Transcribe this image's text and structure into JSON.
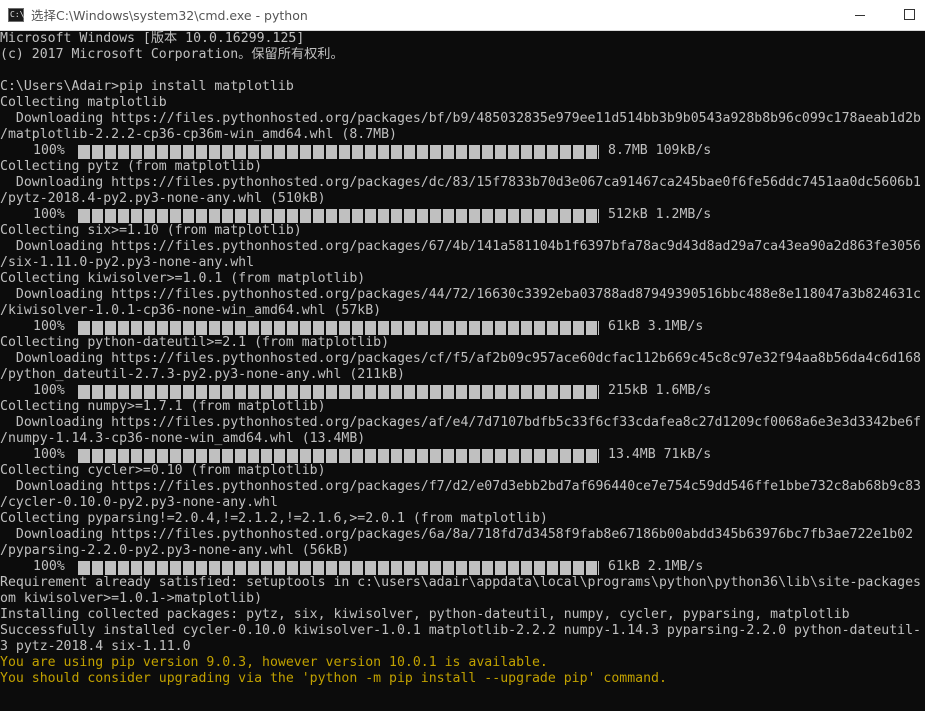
{
  "window": {
    "title": "选择C:\\Windows\\system32\\cmd.exe - python",
    "icon_text": "C:\\"
  },
  "console": {
    "lines": [
      {
        "kind": "text",
        "text": "Microsoft Windows [版本 10.0.16299.125]"
      },
      {
        "kind": "text",
        "text": "(c) 2017 Microsoft Corporation。保留所有权利。"
      },
      {
        "kind": "text",
        "text": ""
      },
      {
        "kind": "text",
        "text": "C:\\Users\\Adair>pip install matplotlib"
      },
      {
        "kind": "text",
        "text": "Collecting matplotlib"
      },
      {
        "kind": "text",
        "text": "  Downloading https://files.pythonhosted.org/packages/bf/b9/485032835e979ee11d514bb3b9b0543a928b8b96c099c178aeab1d2b"
      },
      {
        "kind": "text",
        "text": "/matplotlib-2.2.2-cp36-cp36m-win_amd64.whl (8.7MB)"
      },
      {
        "kind": "progress",
        "percent": "100%",
        "speed": "8.7MB 109kB/s"
      },
      {
        "kind": "text",
        "text": "Collecting pytz (from matplotlib)"
      },
      {
        "kind": "text",
        "text": "  Downloading https://files.pythonhosted.org/packages/dc/83/15f7833b70d3e067ca91467ca245bae0f6fe56ddc7451aa0dc5606b1"
      },
      {
        "kind": "text",
        "text": "/pytz-2018.4-py2.py3-none-any.whl (510kB)"
      },
      {
        "kind": "progress",
        "percent": "100%",
        "speed": "512kB 1.2MB/s"
      },
      {
        "kind": "text",
        "text": "Collecting six>=1.10 (from matplotlib)"
      },
      {
        "kind": "text",
        "text": "  Downloading https://files.pythonhosted.org/packages/67/4b/141a581104b1f6397bfa78ac9d43d8ad29a7ca43ea90a2d863fe3056"
      },
      {
        "kind": "text",
        "text": "/six-1.11.0-py2.py3-none-any.whl"
      },
      {
        "kind": "text",
        "text": "Collecting kiwisolver>=1.0.1 (from matplotlib)"
      },
      {
        "kind": "text",
        "text": "  Downloading https://files.pythonhosted.org/packages/44/72/16630c3392eba03788ad87949390516bbc488e8e118047a3b824631c"
      },
      {
        "kind": "text",
        "text": "/kiwisolver-1.0.1-cp36-none-win_amd64.whl (57kB)"
      },
      {
        "kind": "progress",
        "percent": "100%",
        "speed": "61kB 3.1MB/s"
      },
      {
        "kind": "text",
        "text": "Collecting python-dateutil>=2.1 (from matplotlib)"
      },
      {
        "kind": "text",
        "text": "  Downloading https://files.pythonhosted.org/packages/cf/f5/af2b09c957ace60dcfac112b669c45c8c97e32f94aa8b56da4c6d168"
      },
      {
        "kind": "text",
        "text": "/python_dateutil-2.7.3-py2.py3-none-any.whl (211kB)"
      },
      {
        "kind": "progress",
        "percent": "100%",
        "speed": "215kB 1.6MB/s"
      },
      {
        "kind": "text",
        "text": "Collecting numpy>=1.7.1 (from matplotlib)"
      },
      {
        "kind": "text",
        "text": "  Downloading https://files.pythonhosted.org/packages/af/e4/7d7107bdfb5c33f6cf33cdafea8c27d1209cf0068a6e3e3d3342be6f"
      },
      {
        "kind": "text",
        "text": "/numpy-1.14.3-cp36-none-win_amd64.whl (13.4MB)"
      },
      {
        "kind": "progress",
        "percent": "100%",
        "speed": "13.4MB 71kB/s"
      },
      {
        "kind": "text",
        "text": "Collecting cycler>=0.10 (from matplotlib)"
      },
      {
        "kind": "text",
        "text": "  Downloading https://files.pythonhosted.org/packages/f7/d2/e07d3ebb2bd7af696440ce7e754c59dd546ffe1bbe732c8ab68b9c83"
      },
      {
        "kind": "text",
        "text": "/cycler-0.10.0-py2.py3-none-any.whl"
      },
      {
        "kind": "text",
        "text": "Collecting pyparsing!=2.0.4,!=2.1.2,!=2.1.6,>=2.0.1 (from matplotlib)"
      },
      {
        "kind": "text",
        "text": "  Downloading https://files.pythonhosted.org/packages/6a/8a/718fd7d3458f9fab8e67186b00abdd345b63976bc7fb3ae722e1b02"
      },
      {
        "kind": "text",
        "text": "/pyparsing-2.2.0-py2.py3-none-any.whl (56kB)"
      },
      {
        "kind": "progress",
        "percent": "100%",
        "speed": "61kB 2.1MB/s"
      },
      {
        "kind": "text",
        "text": "Requirement already satisfied: setuptools in c:\\users\\adair\\appdata\\local\\programs\\python\\python36\\lib\\site-packages"
      },
      {
        "kind": "text",
        "text": "om kiwisolver>=1.0.1->matplotlib)"
      },
      {
        "kind": "text",
        "text": "Installing collected packages: pytz, six, kiwisolver, python-dateutil, numpy, cycler, pyparsing, matplotlib"
      },
      {
        "kind": "text",
        "text": "Successfully installed cycler-0.10.0 kiwisolver-1.0.1 matplotlib-2.2.2 numpy-1.14.3 pyparsing-2.2.0 python-dateutil-"
      },
      {
        "kind": "text",
        "text": "3 pytz-2018.4 six-1.11.0"
      },
      {
        "kind": "warn",
        "text": "You are using pip version 9.0.3, however version 10.0.1 is available."
      },
      {
        "kind": "warn",
        "text": "You should consider upgrading via the 'python -m pip install --upgrade pip' command."
      }
    ]
  },
  "colors": {
    "console_bg": "#0c0c0c",
    "console_text": "#c0c0c0",
    "warning_text": "#c1a100"
  }
}
